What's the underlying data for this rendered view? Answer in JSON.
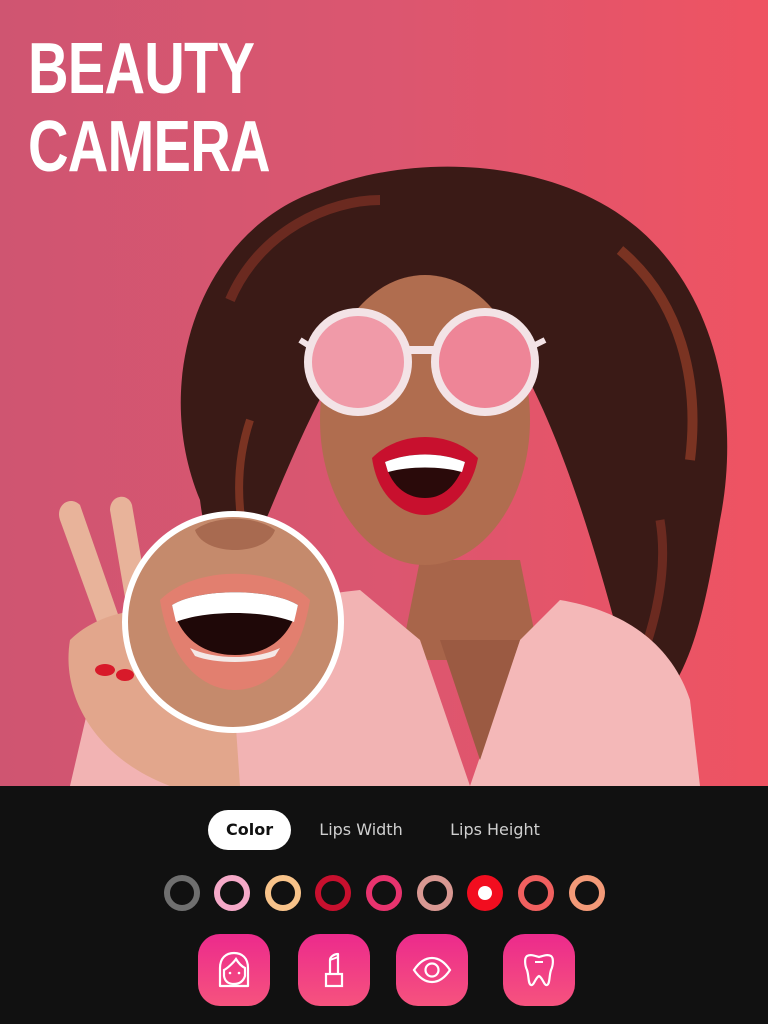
{
  "hero": {
    "headline_line1": "BEAUTY",
    "headline_line2": "CAMERA",
    "background_colors": [
      "#cf5571",
      "#ef5362"
    ]
  },
  "magnifier": {
    "subject": "zoomed-lips-preview",
    "lip_color": "#e27f6f"
  },
  "panel": {
    "tabs": [
      {
        "label": "Color",
        "active": true
      },
      {
        "label": "Lips Width",
        "active": false
      },
      {
        "label": "Lips Height",
        "active": false
      }
    ],
    "swatches": [
      {
        "color": "#6f6f6f",
        "selected": false
      },
      {
        "color": "#f5a9c8",
        "selected": false
      },
      {
        "color": "#f8c38a",
        "selected": false
      },
      {
        "color": "#c8102e",
        "selected": false
      },
      {
        "color": "#e8336e",
        "selected": false
      },
      {
        "color": "#d99892",
        "selected": false
      },
      {
        "color": "#f20d1f",
        "selected": true
      },
      {
        "color": "#f0605f",
        "selected": false
      },
      {
        "color": "#f39a78",
        "selected": false
      }
    ],
    "tools": [
      {
        "icon": "face-icon",
        "label": "Face"
      },
      {
        "icon": "lipstick-icon",
        "label": "Lipstick"
      },
      {
        "icon": "eye-icon",
        "label": "Eyes"
      },
      {
        "icon": "tooth-icon",
        "label": "Teeth"
      }
    ],
    "tool_gradient": [
      "#ec2a8c",
      "#f6537e"
    ]
  }
}
